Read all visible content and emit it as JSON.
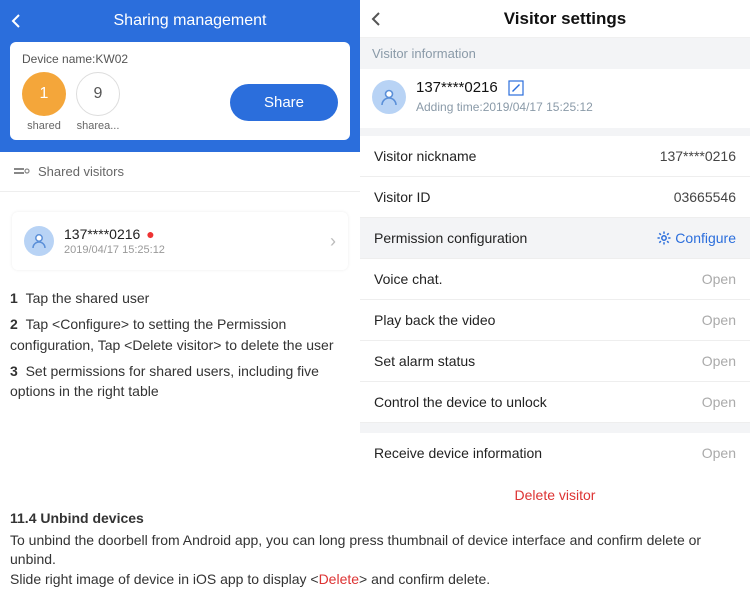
{
  "left": {
    "header_title": "Sharing management",
    "device_name_label": "Device name:KW02",
    "shared_count": "1",
    "shareable_count": "9",
    "shared_label": "shared",
    "shareable_label": "sharea...",
    "share_button": "Share",
    "shared_visitors_header": "Shared visitors",
    "visitor_phone": "137****0216",
    "visitor_time": "2019/04/17 15:25:12"
  },
  "instructions": {
    "step1_num": "1",
    "step1_text": "Tap the shared user",
    "step2_num": "2",
    "step2_text": "Tap <Configure> to setting the Permission configuration, Tap <Delete visitor> to delete the user",
    "step3_num": "3",
    "step3_text": "Set permissions for shared users, including five options in the right table"
  },
  "right": {
    "header_title": "Visitor settings",
    "visitor_info_label": "Visitor information",
    "phone": "137****0216",
    "added_label": "Adding time:2019/04/17 15:25:12",
    "rows": {
      "nickname_label": "Visitor nickname",
      "nickname_value": "137****0216",
      "id_label": "Visitor ID",
      "id_value": "03665546",
      "perm_conf_label": "Permission configuration",
      "configure_label": "Configure",
      "perm1_label": "Voice chat.",
      "perm1_value": "Open",
      "perm2_label": "Play back the video",
      "perm2_value": "Open",
      "perm3_label": "Set alarm status",
      "perm3_value": "Open",
      "perm4_label": "Control the device to unlock",
      "perm4_value": "Open",
      "perm5_label": "Receive device information",
      "perm5_value": "Open"
    },
    "delete_visitor": "Delete visitor"
  },
  "bottom": {
    "heading": "11.4  Unbind devices",
    "p1": "To unbind the doorbell from Android app,  you can long press thumbnail of device interface and  confirm delete or unbind.",
    "p2a": "Slide right image of device in iOS app to display <",
    "p2_red": "Delete",
    "p2b": "> and confirm delete."
  }
}
